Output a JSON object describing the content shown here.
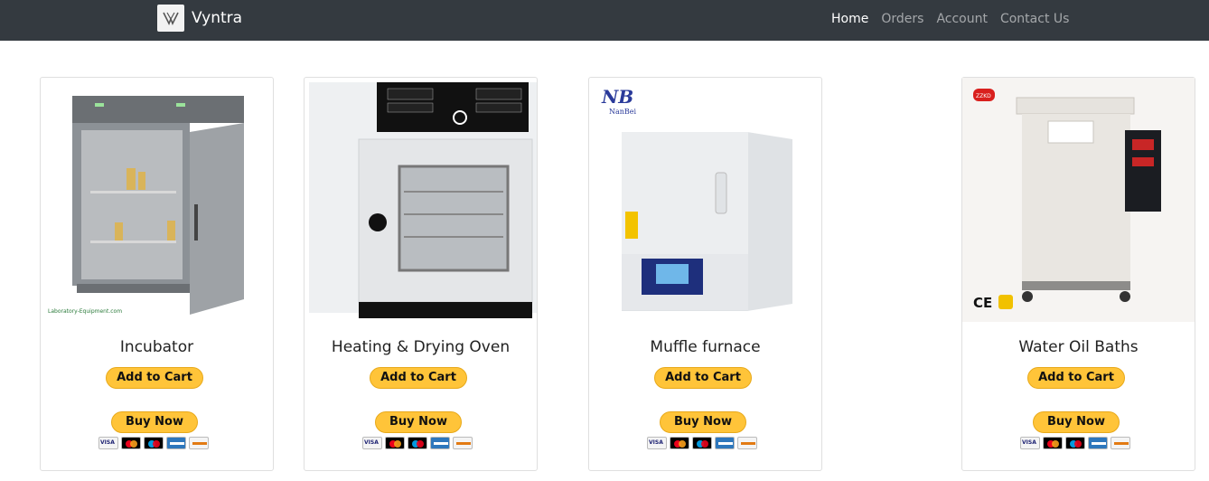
{
  "navbar": {
    "brand_name": "Vyntra",
    "links": [
      {
        "label": "Home",
        "active": true
      },
      {
        "label": "Orders",
        "active": false
      },
      {
        "label": "Account",
        "active": false
      },
      {
        "label": "Contact Us",
        "active": false
      }
    ]
  },
  "products": [
    {
      "title": "Incubator",
      "image_caption": "Laboratory-Equipment.com",
      "add_to_cart_label": "Add to Cart",
      "buy_now_label": "Buy Now"
    },
    {
      "title": "Heating & Drying Oven",
      "add_to_cart_label": "Add to Cart",
      "buy_now_label": "Buy Now"
    },
    {
      "title": "Muffle furnace",
      "image_brand": "NB",
      "image_brand_sub": "NanBei",
      "add_to_cart_label": "Add to Cart",
      "buy_now_label": "Buy Now"
    },
    {
      "title": "Water Oil Baths",
      "image_brand": "ZZKD",
      "image_mark": "CE",
      "add_to_cart_label": "Add to Cart",
      "buy_now_label": "Buy Now"
    }
  ],
  "payment_icons": [
    "visa-icon",
    "mastercard-icon",
    "maestro-icon",
    "amex-icon",
    "discover-icon"
  ],
  "colors": {
    "navbar": "#343a40",
    "paypal_button": "#ffc439"
  }
}
